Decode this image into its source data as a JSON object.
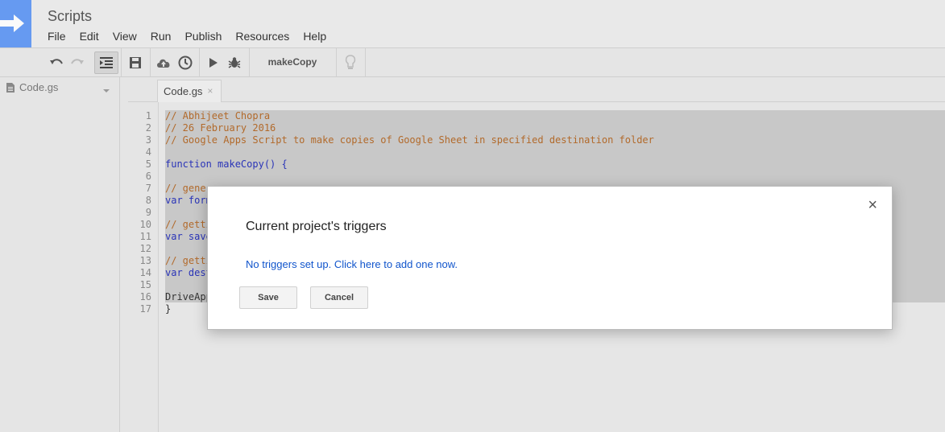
{
  "app": {
    "title": "Scripts"
  },
  "menu": [
    "File",
    "Edit",
    "View",
    "Run",
    "Publish",
    "Resources",
    "Help"
  ],
  "toolbar": {
    "function_select": "makeCopy"
  },
  "sidebar": {
    "file_name": "Code.gs"
  },
  "tabs": [
    {
      "label": "Code.gs",
      "close": "×"
    }
  ],
  "line_numbers": [
    "1",
    "2",
    "3",
    "4",
    "5",
    "6",
    "7",
    "8",
    "9",
    "10",
    "11",
    "12",
    "13",
    "14",
    "15",
    "16",
    "17"
  ],
  "code_lines": [
    "// Abhijeet Chopra",
    "// 26 February 2016",
    "// Google Apps Script to make copies of Google Sheet in specified destination folder",
    "",
    "function makeCopy() {",
    "",
    "// gener",
    "var form",
    "",
    "// getti",
    "var save",
    "",
    "// getti",
    "var dest",
    "",
    "DriveApp",
    "}"
  ],
  "dialog": {
    "title": "Current project's triggers",
    "link": "No triggers set up. Click here to add one now.",
    "save_label": "Save",
    "cancel_label": "Cancel",
    "close": "×"
  },
  "colors": {
    "logo": "#4285f4",
    "link": "#1155cc",
    "comment": "#b26a2b",
    "keyword": "#2a34b8"
  }
}
